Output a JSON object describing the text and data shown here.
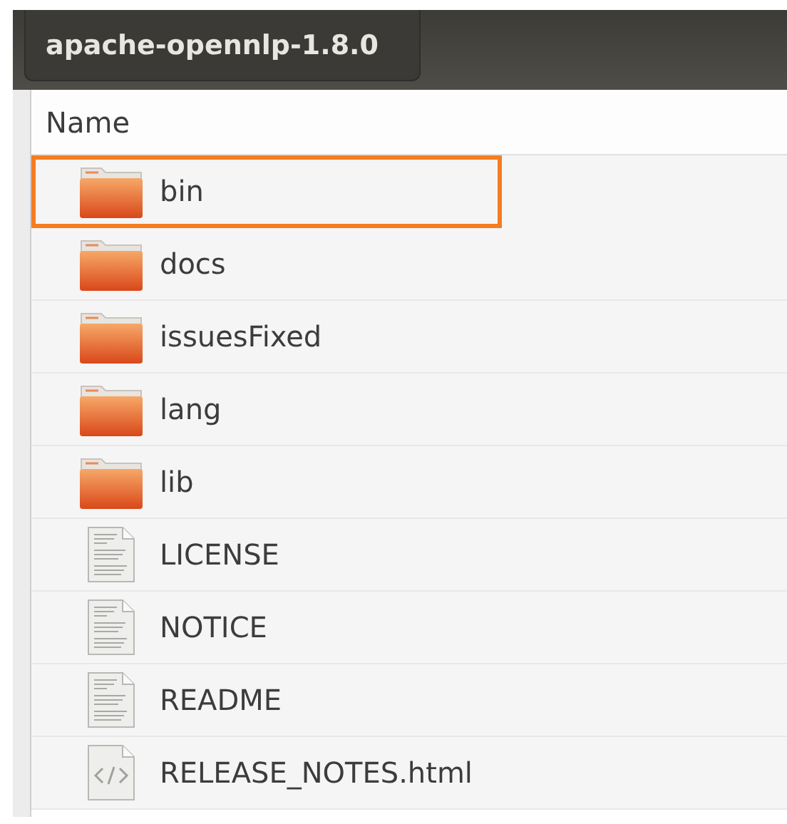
{
  "window": {
    "tab": "apache-opennlp-1.8.0"
  },
  "column": "Name",
  "items": [
    {
      "name": "bin",
      "kind": "folder",
      "highlighted": true
    },
    {
      "name": "docs",
      "kind": "folder",
      "highlighted": false
    },
    {
      "name": "issuesFixed",
      "kind": "folder",
      "highlighted": false
    },
    {
      "name": "lang",
      "kind": "folder",
      "highlighted": false
    },
    {
      "name": "lib",
      "kind": "folder",
      "highlighted": false
    },
    {
      "name": "LICENSE",
      "kind": "text",
      "highlighted": false
    },
    {
      "name": "NOTICE",
      "kind": "text",
      "highlighted": false
    },
    {
      "name": "README",
      "kind": "text",
      "highlighted": false
    },
    {
      "name": "RELEASE_NOTES.html",
      "kind": "html",
      "highlighted": false
    }
  ]
}
